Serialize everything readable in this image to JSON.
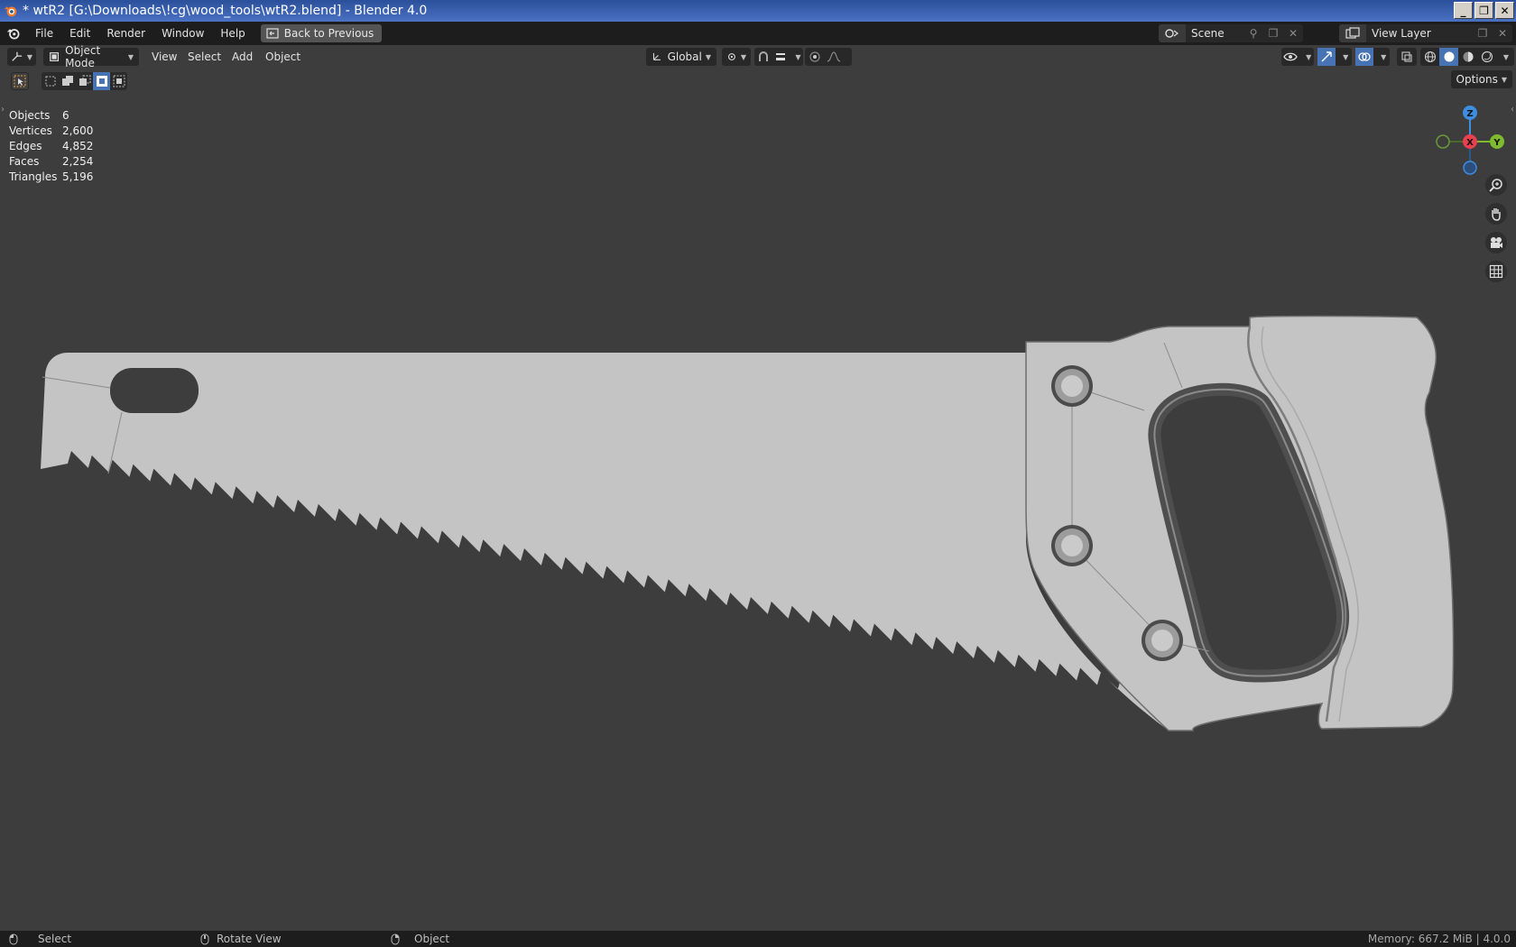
{
  "window": {
    "title": "* wtR2 [G:\\Downloads\\!cg\\wood_tools\\wtR2.blend] - Blender 4.0",
    "minimize": "_",
    "maximize": "❐",
    "close": "✕"
  },
  "menubar": {
    "items": [
      "File",
      "Edit",
      "Render",
      "Window",
      "Help"
    ],
    "back_button": "Back to Previous",
    "scene": "Scene",
    "view_layer": "View Layer"
  },
  "header": {
    "mode": "Object Mode",
    "menus": [
      "View",
      "Select",
      "Add",
      "Object"
    ],
    "orientation": "Global",
    "options": "Options"
  },
  "stats": [
    {
      "label": "Objects",
      "value": "6"
    },
    {
      "label": "Vertices",
      "value": "2,600"
    },
    {
      "label": "Edges",
      "value": "4,852"
    },
    {
      "label": "Faces",
      "value": "2,254"
    },
    {
      "label": "Triangles",
      "value": "5,196"
    }
  ],
  "gizmo": {
    "z": "Z",
    "x": "X",
    "y": "Y"
  },
  "statusbar": {
    "select": "Select",
    "rotate": "Rotate View",
    "object": "Object",
    "memory": "Memory: 667.2 MiB | 4.0.0"
  },
  "colors": {
    "viewport_bg": "#3d3d3d",
    "accent": "#4772b3",
    "axis_x": "#e8404f",
    "axis_y": "#7fbb2e",
    "axis_z": "#3d8de0",
    "model": "#c3c4c3"
  }
}
